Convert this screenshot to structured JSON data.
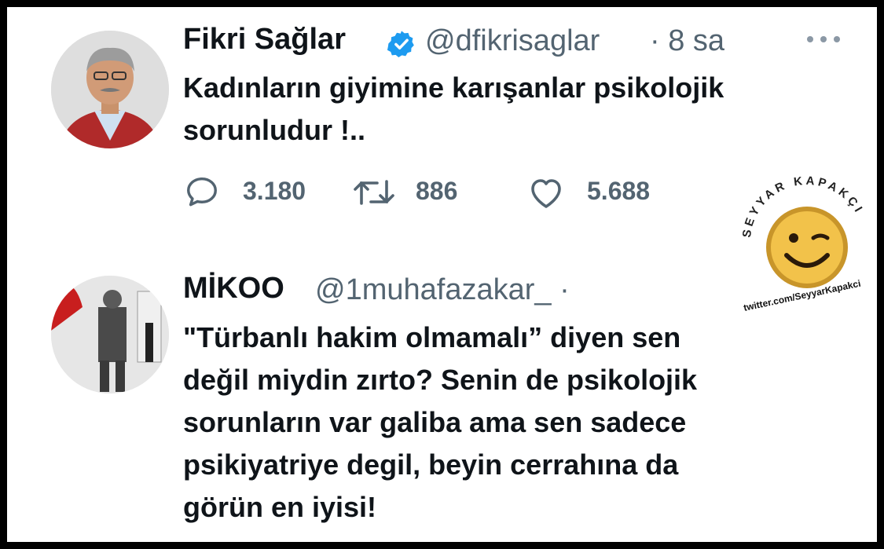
{
  "tweet1": {
    "display_name": "Fikri Sağlar",
    "handle": "@dfikrisaglar",
    "time": "· 8 sa",
    "text_line1": "Kadınların giyimine karışanlar psikolojik",
    "text_line2": "sorunludur !..",
    "replies": "3.180",
    "retweets": "886",
    "likes": "5.688",
    "more_icon": "more-dots",
    "verified_icon": "verified-badge",
    "verified_color": "#1d9bf0"
  },
  "watermark": {
    "arc_text": "SEYYAR KAPAKÇI",
    "link": "twitter.com/SeyyarKapakci"
  },
  "tweet2": {
    "display_name": "MİKOO",
    "handle": "@1muhafazakar_ ·",
    "lines": [
      "\"Türbanlı hakim olmamalı” diyen sen",
      "değil miydin zırto? Senin de psikolojik",
      "sorunların var galiba ama sen sadece",
      "psikiyatriye degil, beyin cerrahına da",
      "görün en iyisi!"
    ]
  }
}
